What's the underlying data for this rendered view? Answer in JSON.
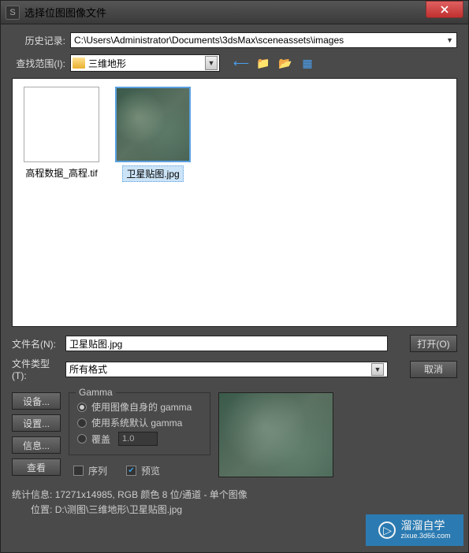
{
  "title": "选择位图图像文件",
  "history": {
    "label": "历史记录:",
    "value": "C:\\Users\\Administrator\\Documents\\3dsMax\\sceneassets\\images"
  },
  "lookin": {
    "label": "查找范围(I):",
    "folder": "三维地形"
  },
  "files": {
    "item0": {
      "name": "高程数据_高程.tif"
    },
    "item1": {
      "name": "卫星贴图.jpg"
    }
  },
  "filename": {
    "label": "文件名(N):",
    "value": "卫星贴图.jpg"
  },
  "filetype": {
    "label": "文件类型(T):",
    "value": "所有格式"
  },
  "open_btn": "打开(O)",
  "cancel_btn": "取消",
  "left": {
    "device": "设备...",
    "setup": "设置...",
    "info": "信息...",
    "view": "查看"
  },
  "gamma": {
    "legend": "Gamma",
    "own": "使用图像自身的 gamma",
    "sys": "使用系统默认 gamma",
    "override": "覆盖",
    "val": "1.0"
  },
  "checks": {
    "sequence": "序列",
    "preview": "预览"
  },
  "stats": {
    "info_lbl": "统计信息:",
    "info_val": "17271x14985, RGB 颜色 8 位/通道 - 单个图像",
    "loc_lbl": "位置:",
    "loc_val": "D:\\测图\\三维地形\\卫星贴图.jpg"
  },
  "watermark": {
    "main": "溜溜自学",
    "sub": "zixue.3d66.com"
  }
}
